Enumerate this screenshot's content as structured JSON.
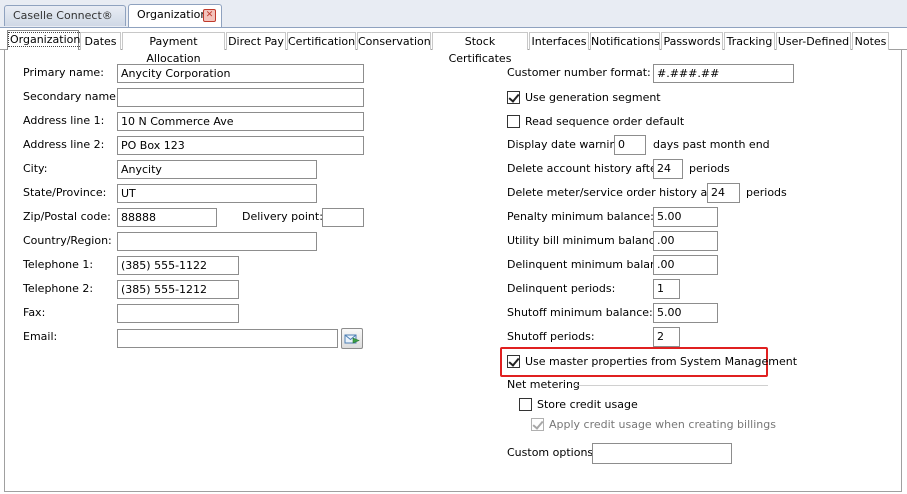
{
  "doc_tabs": [
    {
      "label": "Caselle Connect®"
    },
    {
      "label": "Organization"
    }
  ],
  "sub_tabs": [
    "Organization",
    "Dates",
    "Payment Allocation",
    "Direct Pay",
    "Certification",
    "Conservation",
    "Stock Certificates",
    "Interfaces",
    "Notifications",
    "Passwords",
    "Tracking",
    "User-Defined",
    "Notes"
  ],
  "left": {
    "primary_name": {
      "label": "Primary name:",
      "value": "Anycity Corporation"
    },
    "secondary_name": {
      "label": "Secondary name:",
      "value": ""
    },
    "address1": {
      "label": "Address line 1:",
      "value": "10 N Commerce Ave"
    },
    "address2": {
      "label": "Address line 2:",
      "value": "PO Box 123"
    },
    "city": {
      "label": "City:",
      "value": "Anycity"
    },
    "state": {
      "label": "State/Province:",
      "value": "UT"
    },
    "zip": {
      "label": "Zip/Postal code:",
      "value": "88888"
    },
    "delivery_point": {
      "label": "Delivery point:",
      "value": ""
    },
    "country": {
      "label": "Country/Region:",
      "value": ""
    },
    "telephone1": {
      "label": "Telephone 1:",
      "value": "(385) 555-1122"
    },
    "telephone2": {
      "label": "Telephone 2:",
      "value": "(385) 555-1212"
    },
    "fax": {
      "label": "Fax:",
      "value": ""
    },
    "email": {
      "label": "Email:",
      "value": "",
      "button_icon": "send-email-icon"
    }
  },
  "right": {
    "customer_number_format": {
      "label": "Customer number format:",
      "value": "#.###.##"
    },
    "use_generation_segment": {
      "label": "Use generation segment",
      "checked": true
    },
    "read_sequence_order_default": {
      "label": "Read sequence order default",
      "checked": false
    },
    "display_date_warning": {
      "label": "Display date warning",
      "value": "0",
      "suffix": "days past month end"
    },
    "delete_account_history": {
      "label": "Delete account history after",
      "value": "24",
      "suffix": "periods"
    },
    "delete_meter_history": {
      "label": "Delete meter/service order history after",
      "value": "24",
      "suffix": "periods"
    },
    "penalty_min_balance": {
      "label": "Penalty minimum balance:",
      "value": "5.00"
    },
    "utility_bill_min_balance": {
      "label": "Utility bill minimum balance:",
      "value": ".00"
    },
    "delinquent_min_balance": {
      "label": "Delinquent minimum balance:",
      "value": ".00"
    },
    "delinquent_periods": {
      "label": "Delinquent periods:",
      "value": "1"
    },
    "shutoff_min_balance": {
      "label": "Shutoff minimum balance:",
      "value": "5.00"
    },
    "shutoff_periods": {
      "label": "Shutoff periods:",
      "value": "2"
    },
    "use_master_properties": {
      "label": "Use master properties from System Management",
      "checked": true
    },
    "net_metering": {
      "label": "Net metering"
    },
    "store_credit_usage": {
      "label": "Store credit usage",
      "checked": false
    },
    "apply_credit_usage": {
      "label": "Apply credit usage when creating billings",
      "checked": true,
      "disabled": true
    },
    "custom_options": {
      "label": "Custom options:",
      "value": ""
    }
  },
  "colors": {
    "highlight": "#e02020",
    "tab_border": "#8fa2bf"
  }
}
